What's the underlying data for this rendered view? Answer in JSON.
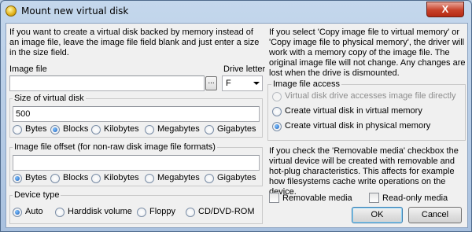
{
  "window": {
    "title": "Mount new virtual disk",
    "close_label": "X"
  },
  "left": {
    "description": "If you want to create a virtual disk backed by memory instead of an image file, leave the image file field blank and just enter a size in the size field.",
    "image_file_label": "Image file",
    "image_file_value": "",
    "browse_label": "...",
    "drive_letter_label": "Drive letter",
    "drive_letter_value": "F",
    "size_group": {
      "label": "Size of virtual disk",
      "value": "500",
      "units": [
        "Bytes",
        "Blocks",
        "Kilobytes",
        "Megabytes",
        "Gigabytes"
      ],
      "selected": "Blocks"
    },
    "offset_group": {
      "label": "Image file offset (for non-raw disk image file formats)",
      "value": "",
      "units": [
        "Bytes",
        "Blocks",
        "Kilobytes",
        "Megabytes",
        "Gigabytes"
      ],
      "selected": "Bytes"
    },
    "device_group": {
      "label": "Device type",
      "options": [
        "Auto",
        "Harddisk volume",
        "Floppy",
        "CD/DVD-ROM"
      ],
      "selected": "Auto"
    }
  },
  "right": {
    "description": "If you select 'Copy image file to virtual memory' or 'Copy image file to physical memory', the driver will work with a memory copy of the image file. The original image file will not change. Any changes are lost when the drive is dismounted.",
    "access_group": {
      "label": "Image file access",
      "options": [
        {
          "label": "Virtual disk drive accesses image file directly",
          "disabled": true
        },
        {
          "label": "Create virtual disk in virtual memory",
          "disabled": false
        },
        {
          "label": "Create virtual disk in physical memory",
          "disabled": false
        }
      ],
      "selected": "Create virtual disk in physical memory"
    },
    "removable_description": "If you check the 'Removable media' checkbox the virtual device will be created with removable and hot-plug characteristics. This affects for example how filesystems cache write operations on the device.",
    "removable_label": "Removable media",
    "readonly_label": "Read-only media",
    "ok_label": "OK",
    "cancel_label": "Cancel"
  }
}
